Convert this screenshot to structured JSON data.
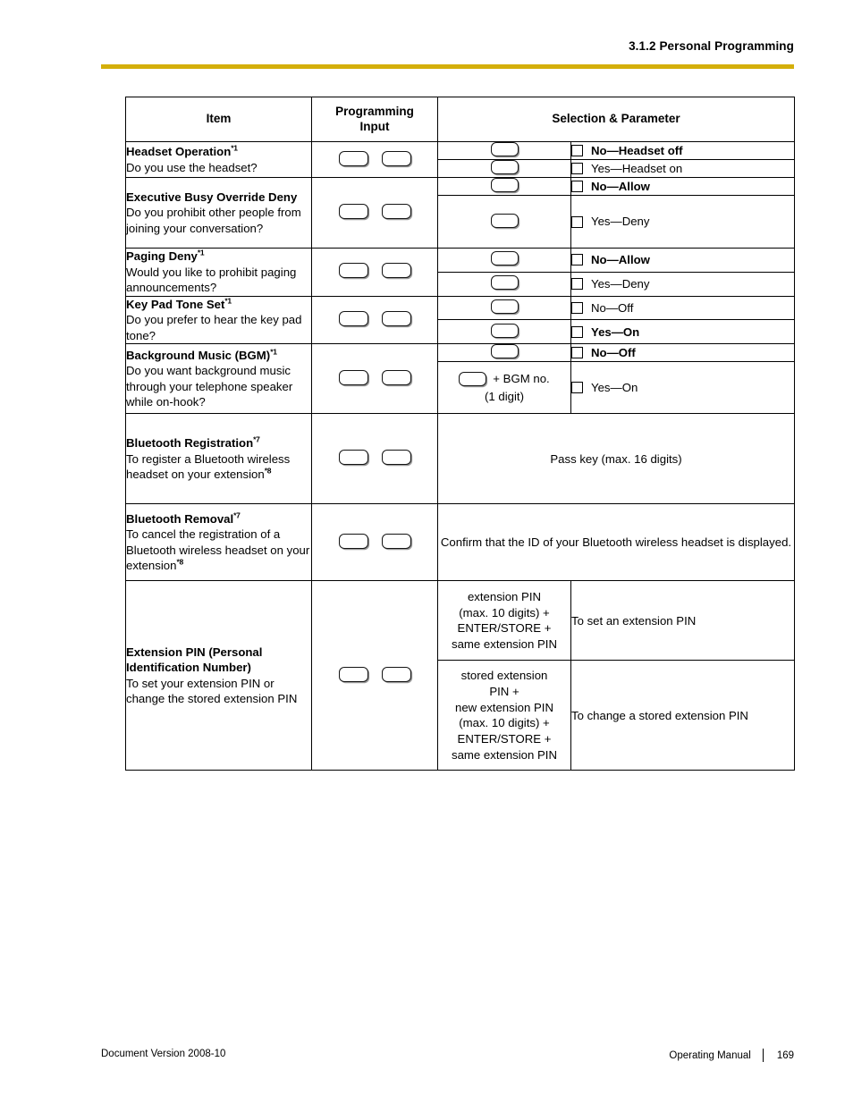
{
  "header": {
    "title": "3.1.2 Personal Programming",
    "rule_color": "#D4AF0A"
  },
  "table": {
    "columns": {
      "item": "Item",
      "programming_input": "Programming\nInput",
      "programming_input_line1": "Programming",
      "programming_input_line2": "Input",
      "selection_parameter": "Selection & Parameter"
    },
    "rows": [
      {
        "item_title": "Headset Operation",
        "item_mark": "*1",
        "item_desc": "Do you use the headset?",
        "keys": 2,
        "options": [
          {
            "key": true,
            "checkbox": true,
            "label": "No—Headset off",
            "bold": true
          },
          {
            "key": true,
            "checkbox": true,
            "label": "Yes—Headset on",
            "bold": false
          }
        ]
      },
      {
        "item_title": "Executive Busy Override Deny",
        "item_mark": "",
        "item_desc": "Do you prohibit other people from joining your conversation?",
        "keys": 2,
        "options": [
          {
            "key": true,
            "checkbox": true,
            "label": "No—Allow",
            "bold": true
          },
          {
            "key": true,
            "checkbox": true,
            "label": "Yes—Deny",
            "bold": false
          }
        ]
      },
      {
        "item_title": "Paging Deny",
        "item_mark": "*1",
        "item_desc": "Would you like to prohibit paging announcements?",
        "keys": 2,
        "options": [
          {
            "key": true,
            "checkbox": true,
            "label": "No—Allow",
            "bold": true
          },
          {
            "key": true,
            "checkbox": true,
            "label": "Yes—Deny",
            "bold": false
          }
        ]
      },
      {
        "item_title": "Key Pad Tone Set",
        "item_mark": "*1",
        "item_desc": "Do you prefer to hear the key pad tone?",
        "keys": 2,
        "options": [
          {
            "key": true,
            "checkbox": true,
            "label": "No—Off",
            "bold": false
          },
          {
            "key": true,
            "checkbox": true,
            "label": "Yes—On",
            "bold": true
          }
        ]
      },
      {
        "item_title": "Background Music (BGM)",
        "item_mark": "*1",
        "item_desc": "Do you want background music through your telephone speaker while on-hook?",
        "keys": 2,
        "options": [
          {
            "key": true,
            "checkbox": true,
            "label": "No—Off",
            "bold": true
          },
          {
            "key": true,
            "key_suffix": "+ BGM no.",
            "key_subnote": "(1 digit)",
            "checkbox": true,
            "label": "Yes—On",
            "bold": false
          }
        ]
      },
      {
        "item_title": "Bluetooth Registration",
        "item_mark": "*7",
        "item_desc": "To register a Bluetooth wireless headset on your extension",
        "item_desc_mark": "*8",
        "keys": 2,
        "merged_text": "Pass key (max. 16 digits)"
      },
      {
        "item_title": "Bluetooth Removal",
        "item_mark": "*7",
        "item_desc": "To cancel the registration of a Bluetooth wireless headset on your extension",
        "item_desc_mark": "*8",
        "keys": 2,
        "merged_text": "Confirm that the ID of your Bluetooth wireless headset is displayed."
      },
      {
        "item_title": "Extension PIN (Personal Identification Number)",
        "item_mark": "",
        "item_desc": "To set your extension PIN or change the stored extension PIN",
        "keys": 2,
        "sequences": [
          {
            "sequence": "extension PIN\n(max. 10 digits) +\nENTER/STORE +\nsame extension PIN",
            "sequence_lines": [
              "extension PIN",
              "(max. 10 digits) +",
              "ENTER/STORE +",
              "same extension PIN"
            ],
            "description": "To set an extension PIN"
          },
          {
            "sequence": "stored extension\nPIN +\nnew extension PIN\n(max. 10 digits) +\nENTER/STORE +\nsame extension PIN",
            "sequence_lines": [
              "stored extension",
              "PIN +",
              "new extension PIN",
              "(max. 10 digits) +",
              "ENTER/STORE +",
              "same extension PIN"
            ],
            "description": "To change a stored extension PIN"
          }
        ]
      }
    ]
  },
  "footer": {
    "document_version": "Document Version  2008-10",
    "manual": "Operating Manual",
    "page_number": "169"
  }
}
